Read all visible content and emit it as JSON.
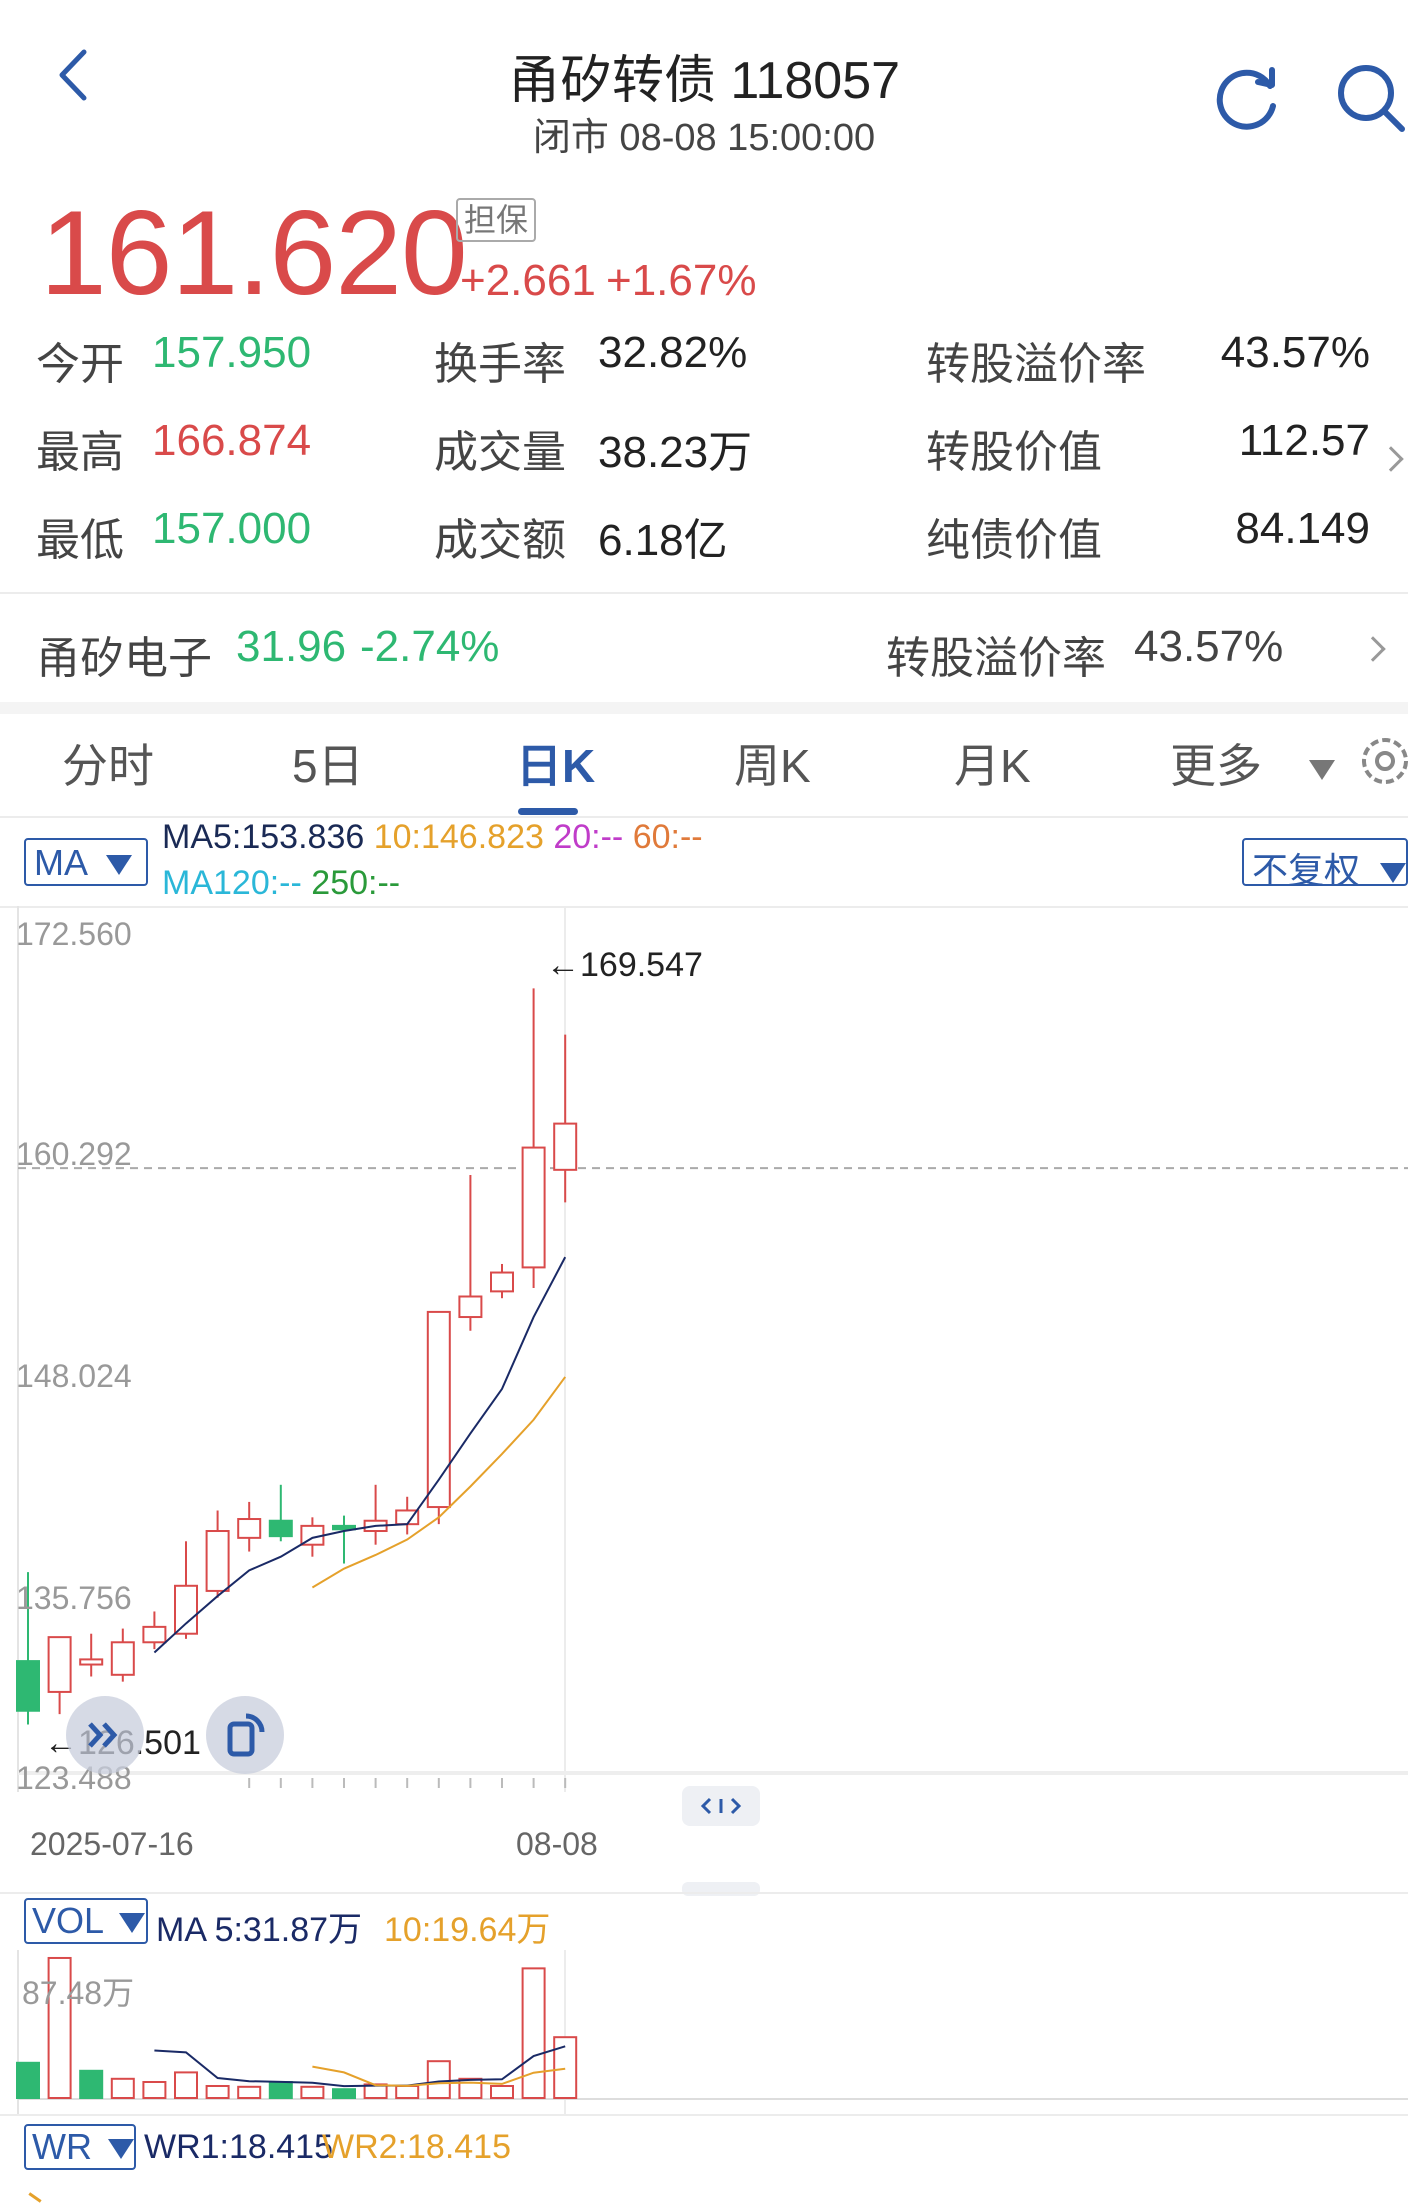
{
  "header": {
    "title": "甬矽转债 118057",
    "subtitle": "闭市 08-08 15:00:00"
  },
  "quote": {
    "price": "161.620",
    "badge": "担保",
    "change": "+2.661",
    "change_pct": "+1.67%"
  },
  "stats": {
    "open_label": "今开",
    "open": "157.950",
    "high_label": "最高",
    "high": "166.874",
    "low_label": "最低",
    "low": "157.000",
    "turnover_label": "换手率",
    "turnover": "32.82%",
    "volume_label": "成交量",
    "volume": "38.23万",
    "amount_label": "成交额",
    "amount": "6.18亿",
    "premium_label": "转股溢价率",
    "premium": "43.57%",
    "conv_value_label": "转股价值",
    "conv_value": "112.57",
    "bond_value_label": "纯债价值",
    "bond_value": "84.149"
  },
  "underlying": {
    "name": "甬矽电子",
    "price": "31.96",
    "change_pct": "-2.74%",
    "premium_label": "转股溢价率",
    "premium": "43.57%"
  },
  "tabs": [
    "分时",
    "5日",
    "日K",
    "周K",
    "月K",
    "更多"
  ],
  "active_tab": "日K",
  "indicators": {
    "ma_selector": "MA",
    "ma5": "MA5:153.836",
    "ma10": "10:146.823",
    "ma20": "20:--",
    "ma60": "60:--",
    "ma120": "MA120:--",
    "ma250": "250:--",
    "adjust": "不复权"
  },
  "colors": {
    "up": "#d94a4a",
    "down": "#2eb872",
    "accent": "#2d5aa8",
    "ma5": "#1a2a66",
    "ma10": "#e5a12b"
  },
  "icons": {
    "back": "chevron-left-icon",
    "refresh": "refresh-icon",
    "search": "search-icon",
    "settings": "gear-icon",
    "collapse": "double-chevron-icon",
    "rotate": "rotate-icon",
    "drag": "drag-handle-icon"
  },
  "chart_data": {
    "type": "candlestick",
    "y_ticks": [
      "172.560",
      "160.292",
      "148.024",
      "135.756",
      "123.488"
    ],
    "ylim": [
      123.488,
      172.56
    ],
    "x_tick_labels": [
      "2025-07-16",
      "08-08"
    ],
    "reference_line": 159.0,
    "max_label": "←169.547",
    "min_label": "←126.501",
    "candles": [
      {
        "o": 130.2,
        "h": 135.4,
        "l": 126.5,
        "c": 127.3
      },
      {
        "o": 128.4,
        "h": 131.2,
        "l": 127.1,
        "c": 131.6
      },
      {
        "o": 130.0,
        "h": 131.8,
        "l": 129.3,
        "c": 130.3
      },
      {
        "o": 129.4,
        "h": 132.1,
        "l": 129.0,
        "c": 131.3
      },
      {
        "o": 131.3,
        "h": 133.1,
        "l": 130.9,
        "c": 132.2
      },
      {
        "o": 131.8,
        "h": 137.2,
        "l": 131.5,
        "c": 134.6
      },
      {
        "o": 134.3,
        "h": 139.0,
        "l": 133.9,
        "c": 137.8
      },
      {
        "o": 137.4,
        "h": 139.5,
        "l": 136.6,
        "c": 138.5
      },
      {
        "o": 138.4,
        "h": 140.5,
        "l": 137.2,
        "c": 137.5
      },
      {
        "o": 137.0,
        "h": 138.6,
        "l": 136.3,
        "c": 138.1
      },
      {
        "o": 138.1,
        "h": 138.7,
        "l": 135.9,
        "c": 137.9
      },
      {
        "o": 137.8,
        "h": 140.5,
        "l": 137.0,
        "c": 138.4
      },
      {
        "o": 138.2,
        "h": 139.8,
        "l": 137.6,
        "c": 139.0
      },
      {
        "o": 139.2,
        "h": 150.6,
        "l": 138.2,
        "c": 150.6
      },
      {
        "o": 150.3,
        "h": 158.6,
        "l": 149.5,
        "c": 151.5
      },
      {
        "o": 151.8,
        "h": 153.4,
        "l": 151.4,
        "c": 152.9
      },
      {
        "o": 153.2,
        "h": 169.5,
        "l": 152.0,
        "c": 160.2
      },
      {
        "o": 158.9,
        "h": 166.8,
        "l": 157.0,
        "c": 161.6
      }
    ],
    "ma5_series": [
      null,
      null,
      null,
      null,
      130.7,
      132.4,
      134.0,
      135.5,
      136.3,
      137.4,
      137.8,
      138.1,
      138.2,
      140.8,
      143.5,
      146.1,
      150.3,
      153.8
    ],
    "ma10_series": [
      null,
      null,
      null,
      null,
      null,
      null,
      null,
      null,
      null,
      134.5,
      135.6,
      136.4,
      137.3,
      138.6,
      140.4,
      142.3,
      144.3,
      146.8
    ],
    "volume": {
      "selector": "VOL",
      "ma5_label": "MA 5:31.87万",
      "ma10_label": "10:19.64万",
      "y_tick": "87.48万",
      "values": [
        22,
        87.5,
        17,
        12,
        10,
        16,
        7.5,
        7,
        10,
        7,
        5.5,
        8.5,
        7.5,
        23,
        12,
        7.5,
        81,
        38
      ],
      "up": [
        false,
        true,
        false,
        true,
        true,
        true,
        true,
        true,
        false,
        true,
        false,
        true,
        true,
        true,
        true,
        true,
        true,
        true
      ],
      "ma5": [
        null,
        null,
        null,
        null,
        29.7,
        28.5,
        12.5,
        10.5,
        10.1,
        9.5,
        7.4,
        7.7,
        7.7,
        10.3,
        11.3,
        11.7,
        26.2,
        32.3
      ],
      "ma10": [
        null,
        null,
        null,
        null,
        null,
        null,
        null,
        null,
        null,
        19.6,
        16.0,
        8.0,
        7.6,
        9.2,
        9.6,
        8.8,
        15.8,
        18.3
      ]
    },
    "wr": {
      "selector": "WR",
      "wr1": "WR1:18.415",
      "wr2": "WR2:18.415"
    }
  }
}
